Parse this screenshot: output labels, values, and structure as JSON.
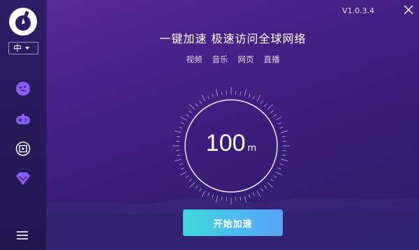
{
  "app": {
    "version": "V1.0.3.4"
  },
  "sidebar": {
    "language": "中",
    "items": [
      {
        "icon": "emoji-icon"
      },
      {
        "icon": "gamepad-icon"
      },
      {
        "icon": "video-icon"
      },
      {
        "icon": "diamond-icon"
      }
    ],
    "menu_icon": "menu-icon"
  },
  "main": {
    "headline": "一键加速  极速访问全球网络",
    "tags": [
      "视频",
      "音乐",
      "网页",
      "直播"
    ],
    "speed": {
      "value": "100",
      "unit": "m"
    },
    "start_button": "开始加速"
  },
  "colors": {
    "sidebar_bg": "#2c1d66",
    "main_bg": "#482289",
    "button_start": "#3fd9d8",
    "button_end": "#5aa2f5",
    "accent_icon": "#8a5cf0"
  }
}
